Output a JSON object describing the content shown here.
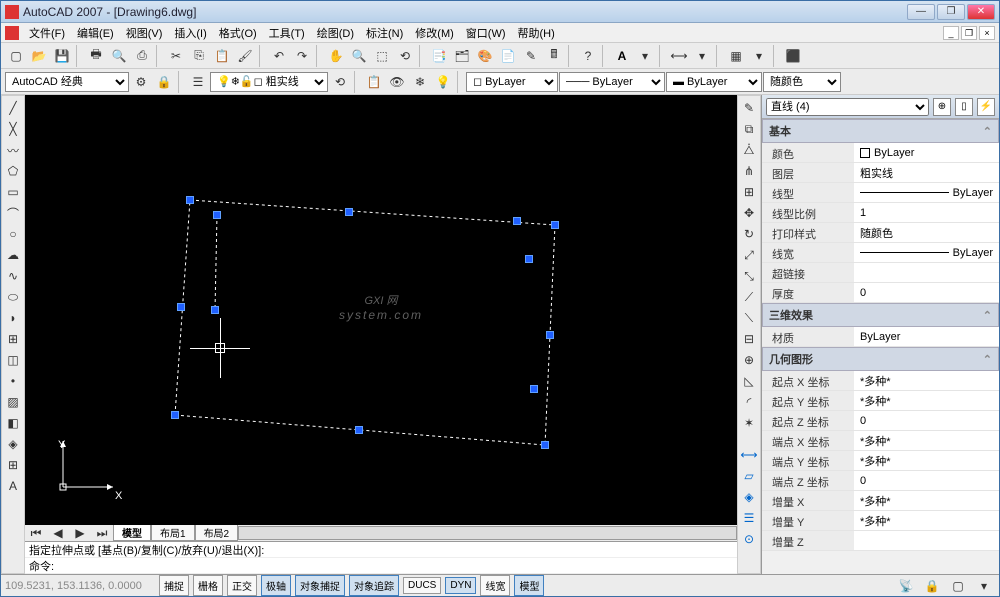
{
  "title": "AutoCAD 2007 - [Drawing6.dwg]",
  "winbtns": {
    "min": "—",
    "max": "❐",
    "close": "✕"
  },
  "menu": [
    "文件(F)",
    "编辑(E)",
    "视图(V)",
    "插入(I)",
    "格式(O)",
    "工具(T)",
    "绘图(D)",
    "标注(N)",
    "修改(M)",
    "窗口(W)",
    "帮助(H)"
  ],
  "doc_ctrls": {
    "min": "_",
    "restore": "❐",
    "close": "×"
  },
  "workspace_combo": "AutoCAD 经典",
  "layer_combo": "粗实线",
  "color_combo": "ByLayer",
  "linetype_combo": "ByLayer",
  "lineweight_combo": "ByLayer",
  "plotstyle_combo": "随颜色",
  "layout_tabs": [
    "模型",
    "布局1",
    "布局2"
  ],
  "cmd_hist": "指定拉伸点或 [基点(B)/复制(C)/放弃(U)/退出(X)]:",
  "cmd_prompt": "命令:",
  "status": {
    "coords": "109.5231, 153.1136, 0.0000",
    "flags": [
      "捕捉",
      "栅格",
      "正交",
      "极轴",
      "对象捕捉",
      "对象追踪",
      "DUCS",
      "DYN",
      "线宽",
      "模型"
    ]
  },
  "prop": {
    "object_label": "直线 (4)",
    "sections": {
      "basic": {
        "title": "基本"
      },
      "threeD": {
        "title": "三维效果"
      },
      "geom": {
        "title": "几何图形"
      }
    },
    "rows": {
      "color_k": "颜色",
      "color_v": "ByLayer",
      "layer_k": "图层",
      "layer_v": "粗实线",
      "ltype_k": "线型",
      "ltype_v": "ByLayer",
      "ltscale_k": "线型比例",
      "ltscale_v": "1",
      "pstyle_k": "打印样式",
      "pstyle_v": "随颜色",
      "lweight_k": "线宽",
      "lweight_v": "ByLayer",
      "hyper_k": "超链接",
      "hyper_v": "",
      "thick_k": "厚度",
      "thick_v": "0",
      "mat_k": "材质",
      "mat_v": "ByLayer",
      "sx_k": "起点 X 坐标",
      "sx_v": "*多种*",
      "sy_k": "起点 Y 坐标",
      "sy_v": "*多种*",
      "sz_k": "起点 Z 坐标",
      "sz_v": "0",
      "ex_k": "端点 X 坐标",
      "ex_v": "*多种*",
      "ey_k": "端点 Y 坐标",
      "ey_v": "*多种*",
      "ez_k": "端点 Z 坐标",
      "ez_v": "0",
      "dx_k": "增量 X",
      "dx_v": "*多种*",
      "dy_k": "增量 Y",
      "dy_v": "*多种*",
      "dz_k": "增量 Z"
    }
  },
  "watermark": {
    "main": "GXI 网",
    "sub": "system.com"
  }
}
